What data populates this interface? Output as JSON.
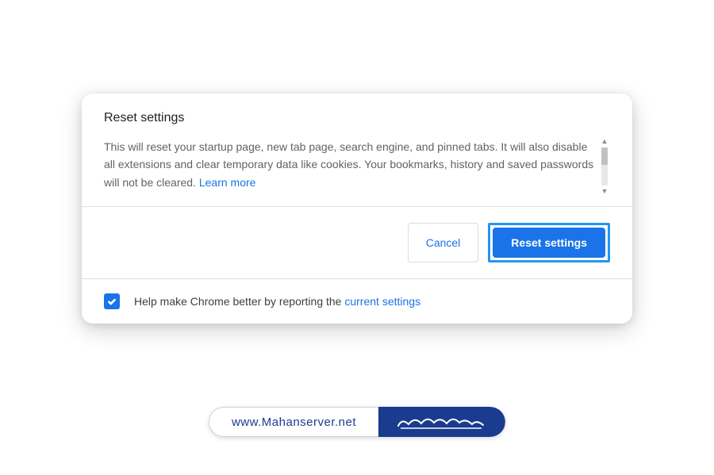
{
  "dialog": {
    "title": "Reset settings",
    "description": "This will reset your startup page, new tab page, search engine, and pinned tabs. It will also disable all extensions and clear temporary data like cookies. Your bookmarks, history and saved passwords will not be cleared.",
    "learn_more": "Learn more",
    "cancel_label": "Cancel",
    "reset_label": "Reset settings",
    "checkbox_text": "Help make Chrome better by reporting the ",
    "checkbox_link": "current settings",
    "checkbox_checked": true
  },
  "watermark": {
    "url": "www.Mahanserver.net"
  }
}
